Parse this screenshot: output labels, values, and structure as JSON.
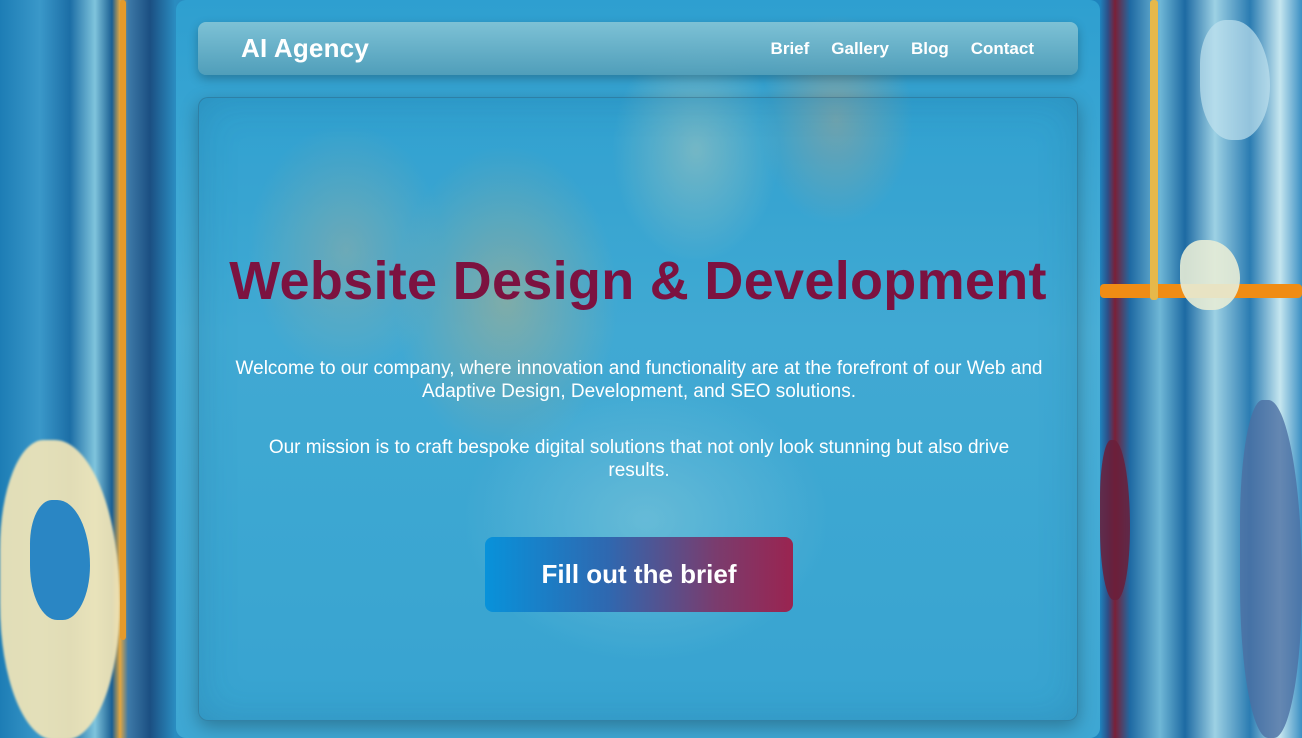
{
  "header": {
    "brand": "AI Agency",
    "nav": [
      "Brief",
      "Gallery",
      "Blog",
      "Contact"
    ]
  },
  "hero": {
    "title": "Website Design & Development",
    "paragraph_1": "Welcome to our company, where innovation and functionality are at the forefront of our Web and Adaptive Design, Development, and SEO solutions.",
    "paragraph_2": "Our mission is to craft bespoke digital solutions that not only look stunning but also drive results.",
    "cta_label": "Fill out the brief"
  },
  "colors": {
    "title": "#7c1240",
    "text": "#ffffff",
    "cta_start": "#0892da",
    "cta_end": "#9a2450"
  }
}
